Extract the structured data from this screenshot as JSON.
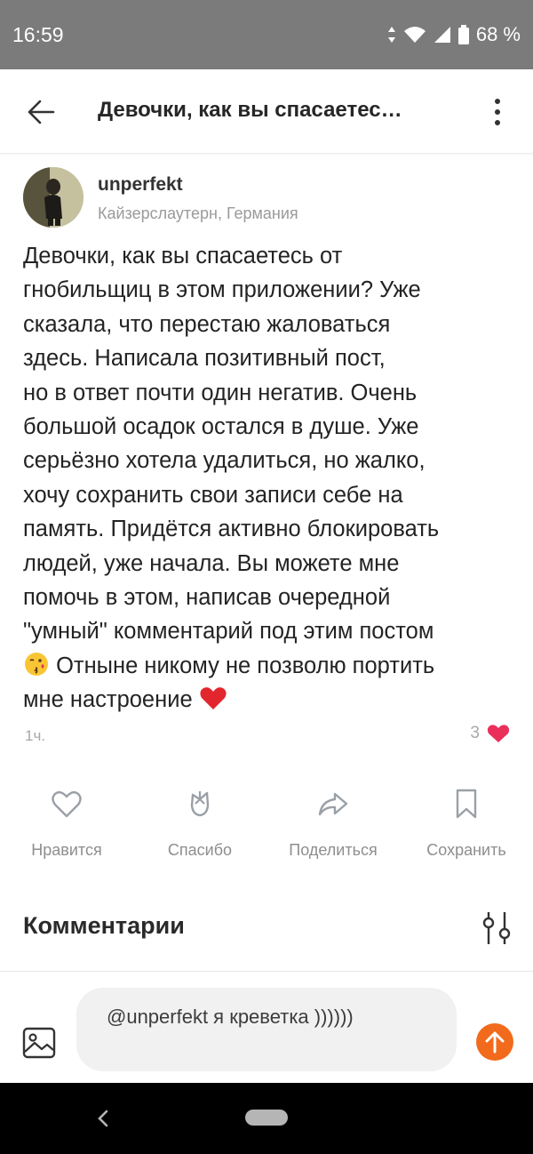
{
  "status_bar": {
    "time": "16:59",
    "battery": "68 %"
  },
  "header": {
    "title": "Девочки, как вы спасаетес…"
  },
  "author": {
    "name": "unperfekt",
    "location": "Кайзерслаутерн, Германия"
  },
  "post": {
    "lines": [
      "Девочки, как вы спасаетесь от",
      "гнобильщиц в этом приложении? Уже",
      "сказала, что перестаю жаловаться",
      "здесь. Написала позитивный пост,",
      "но в ответ почти один негатив. Очень",
      "большой осадок остался в душе. Уже",
      "серьёзно хотела удалиться, но жалко,",
      "хочу сохранить свои записи себе на",
      "память. Придётся активно блокировать",
      "людей, уже начала. Вы можете мне",
      "помочь в этом, написав очередной",
      "\"умный\" комментарий под этим постом",
      " Отныне никому не позволю портить",
      "мне настроение "
    ],
    "time": "1ч.",
    "likes": "3"
  },
  "actions": {
    "like": "Нравится",
    "thanks": "Спасибо",
    "share": "Поделиться",
    "save": "Сохранить"
  },
  "comments": {
    "title": "Комментарии"
  },
  "composer": {
    "text": "@unperfekt я креветка ))))))"
  },
  "colors": {
    "accent": "#f26a1b",
    "heart": "#ea2f5b",
    "icon_gray": "#9aa0a6"
  },
  "icons": [
    "back-arrow-icon",
    "more-vert-icon",
    "kiss-emoji-icon",
    "red-heart-emoji-icon",
    "heart-icon",
    "tulip-icon",
    "share-arrow-icon",
    "bookmark-icon",
    "filter-sliders-icon",
    "image-icon",
    "send-arrow-icon"
  ]
}
